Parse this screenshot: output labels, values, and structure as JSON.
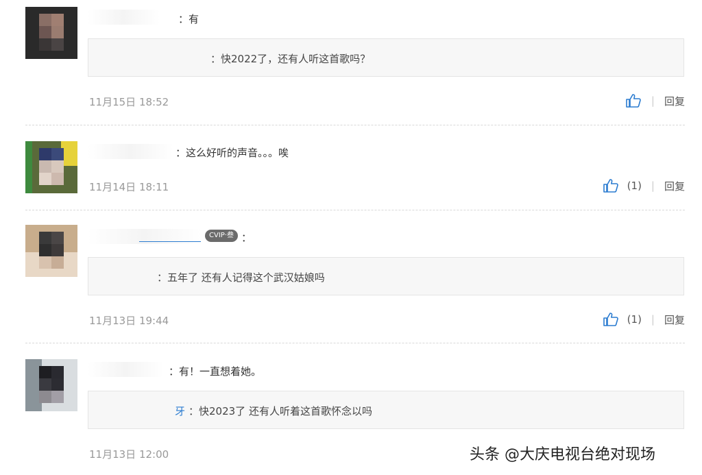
{
  "comments": [
    {
      "text": "：有",
      "quote": "：快2022了，还有人听这首歌吗？",
      "time": "11月15日 18:52",
      "likes": "",
      "reply": "回复"
    },
    {
      "text": "：这么好听的声音。。。唉",
      "time": "11月14日 18:11",
      "likes": "(1)",
      "reply": "回复"
    },
    {
      "text": "：",
      "badge": "CVIP·叁",
      "quote": "：五年了 还有人记得这个武汉姑娘吗",
      "time": "11月13日 19:44",
      "likes": "(1)",
      "reply": "回复"
    },
    {
      "text": "：有！一直想着她。",
      "quote": "：快2023了 还有人听着这首歌怀念以吗",
      "quote_prefix": "牙",
      "time": "11月13日 12:00",
      "reply": "回复"
    }
  ],
  "separator": "|",
  "icons": {
    "like": "thumbs-up-icon",
    "like_color": "#2a7bd0"
  },
  "watermark": "头条 @大庆电视台绝对现场"
}
